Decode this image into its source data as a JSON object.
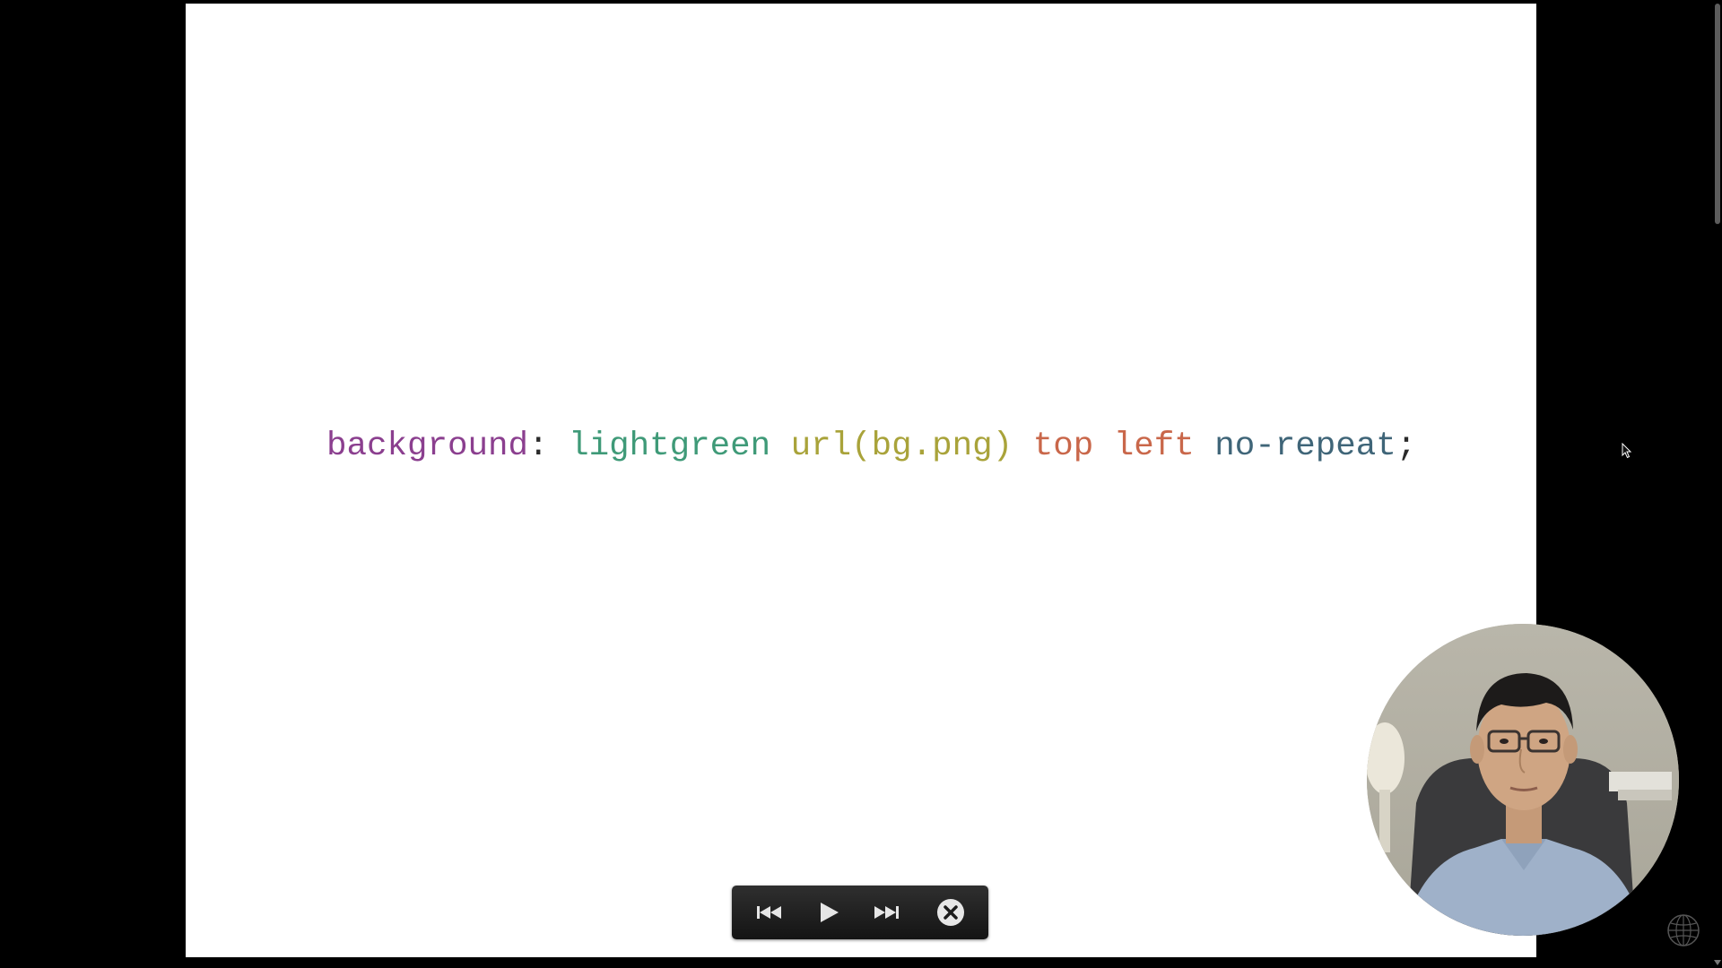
{
  "slide": {
    "code_tokens": [
      {
        "text": "background",
        "color": "#8b3f8f"
      },
      {
        "text": ": ",
        "color": "#2a2a2a"
      },
      {
        "text": "lightgreen",
        "color": "#3f9a78"
      },
      {
        "text": " ",
        "color": "#2a2a2a"
      },
      {
        "text": "url(bg.png)",
        "color": "#a9a33a"
      },
      {
        "text": " ",
        "color": "#2a2a2a"
      },
      {
        "text": "top",
        "color": "#c9674a"
      },
      {
        "text": " ",
        "color": "#2a2a2a"
      },
      {
        "text": "left",
        "color": "#c9674a"
      },
      {
        "text": " ",
        "color": "#2a2a2a"
      },
      {
        "text": "no-repeat",
        "color": "#3f6578"
      },
      {
        "text": ";",
        "color": "#2a2a2a"
      }
    ]
  },
  "controls": {
    "previous_icon": "skip-previous-icon",
    "play_icon": "play-icon",
    "next_icon": "skip-next-icon",
    "close_icon": "close-circle-icon"
  },
  "webcam": {
    "icon": "presenter-video"
  },
  "colors": {
    "background": "#000000",
    "slide": "#ffffff",
    "control_bar": "#1c1c1c"
  }
}
